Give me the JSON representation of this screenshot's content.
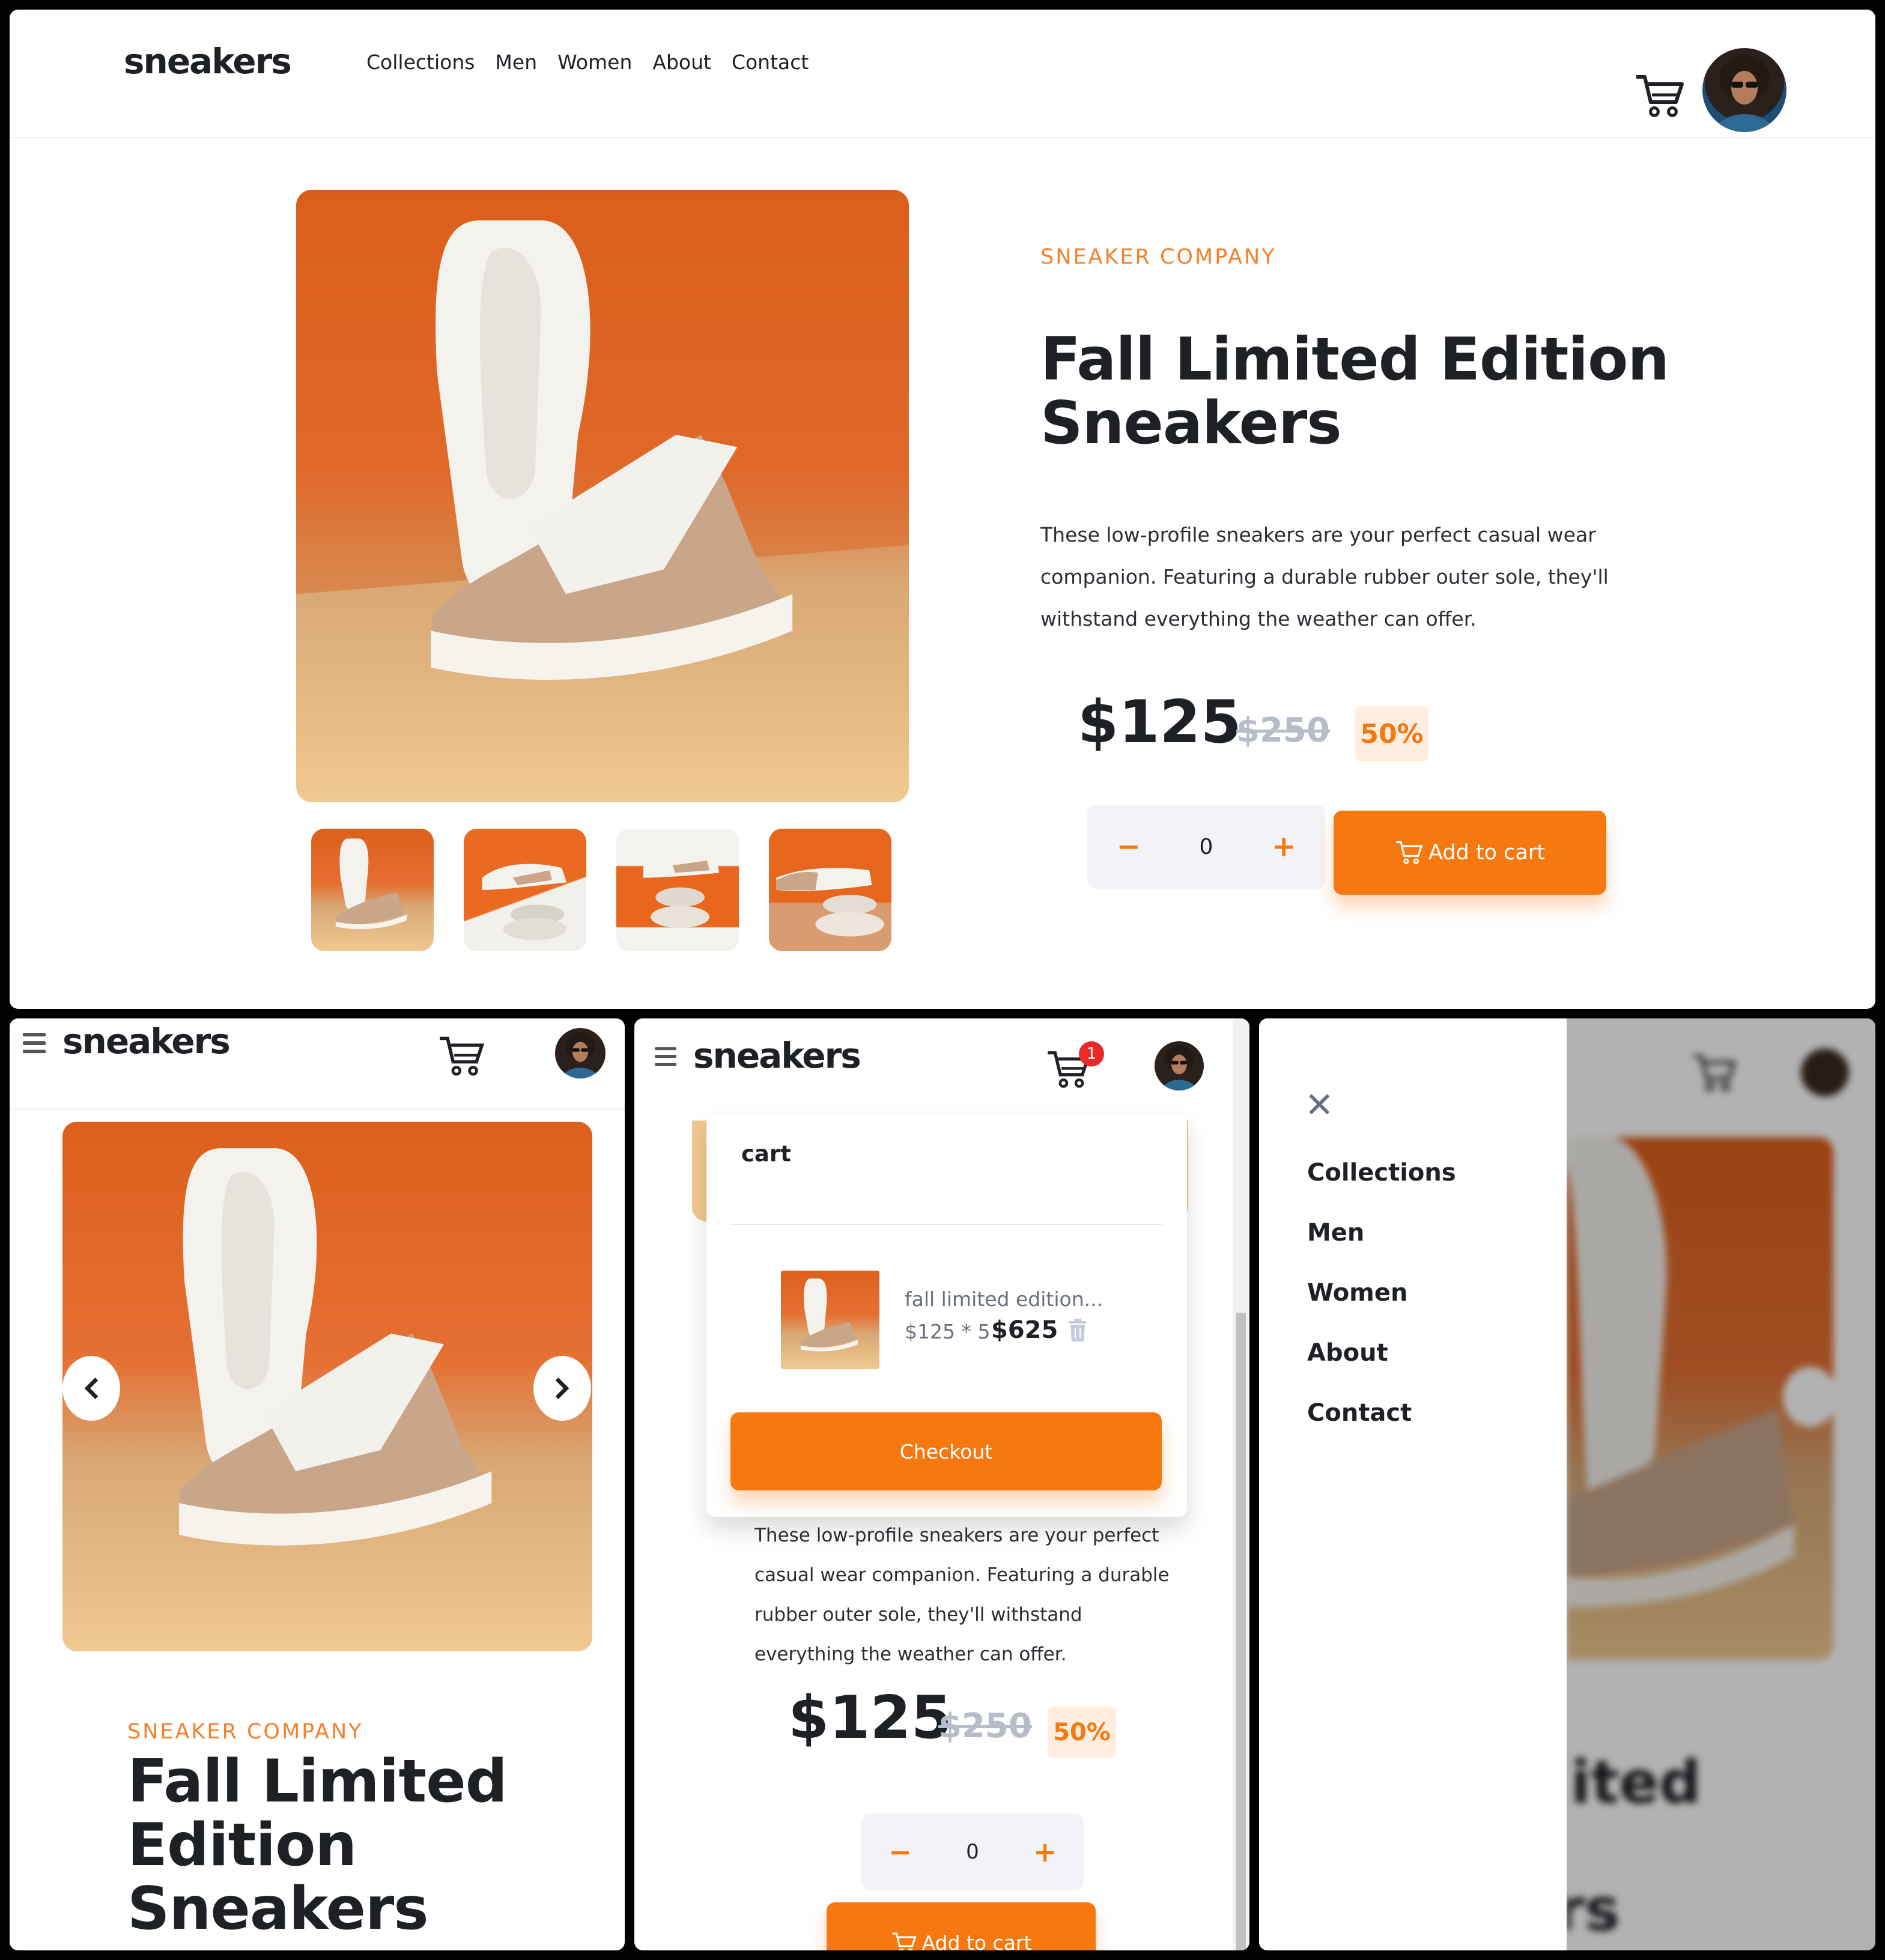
{
  "brand": {
    "logo": "sneakers"
  },
  "nav": {
    "items": [
      "Collections",
      "Men",
      "Women",
      "About",
      "Contact"
    ]
  },
  "product": {
    "company": "SNEAKER COMPANY",
    "title_line1": "Fall Limited Edition",
    "title_line2": "Sneakers",
    "mobile_title": [
      "Fall Limited",
      "Edition",
      "Sneakers"
    ],
    "description": "These low-profile sneakers are your perfect casual wear companion. Featuring a durable rubber outer sole, they'll withstand everything the weather can offer.",
    "price": "$125",
    "old_price": "$250",
    "discount": "50%",
    "quantity": "0",
    "minus": "−",
    "plus": "+",
    "add_to_cart": "Add to cart"
  },
  "cart": {
    "title": "cart",
    "badge_count": "1",
    "item_name": "fall limited edition...",
    "item_calc": "$125 * 5",
    "item_total": "$625",
    "checkout": "Checkout"
  },
  "menu": {
    "close_symbol": "✕"
  },
  "colors": {
    "accent": "#f7780f",
    "accent_light": "#ffede0",
    "text": "#1d2025",
    "muted": "#b6bcc8",
    "badge": "#ea2a2a"
  },
  "icons": [
    "cart-icon",
    "avatar",
    "hamburger-icon",
    "chevron-left-icon",
    "chevron-right-icon",
    "trash-icon",
    "close-icon"
  ]
}
